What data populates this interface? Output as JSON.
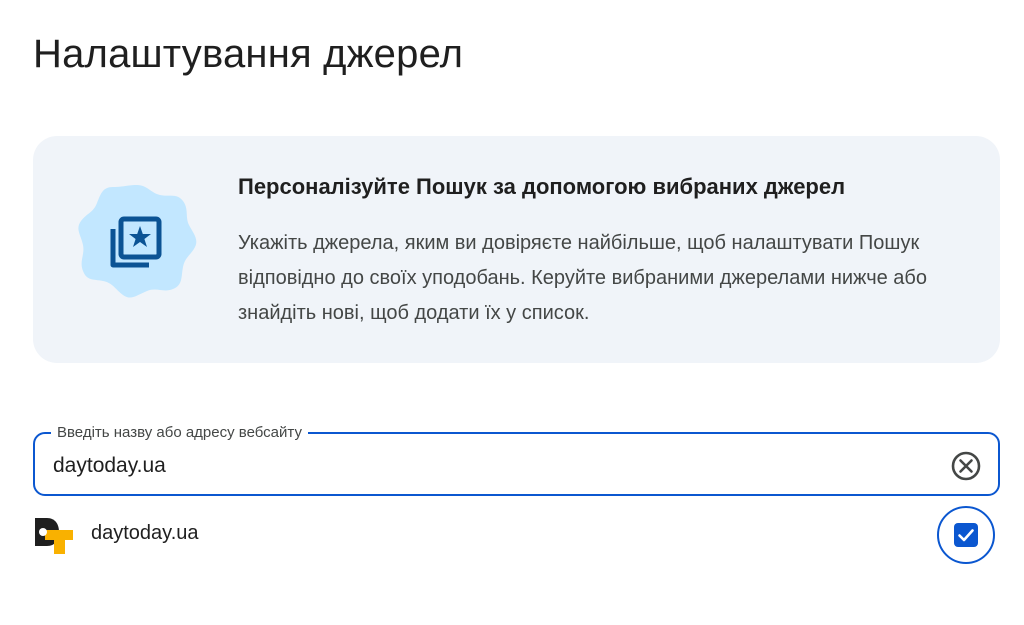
{
  "page": {
    "title": "Налаштування джерел"
  },
  "info_card": {
    "icon": "starred-photo-library-icon",
    "heading": "Персоналізуйте Пошук за допомогою вибраних джерел",
    "body": "Укажіть джерела, яким ви довіряєте найбільше, щоб налаштувати Пошук відповідно до своїх уподобань. Керуйте вибраними джерелами нижче або знайдіть нові, щоб додати їх у список."
  },
  "search": {
    "label": "Введіть назву або адресу вебсайту",
    "value": "daytoday.ua",
    "clear_icon": "clear-circle-icon"
  },
  "results": [
    {
      "name": "daytoday.ua",
      "logo": "daytoday-logo-icon",
      "checked": true
    }
  ],
  "colors": {
    "accent": "#0b57d0",
    "card_background": "#f0f4f9",
    "illustration_bg": "#c2e7ff",
    "illustration_fg": "#0b5394",
    "logo_black": "#1f1f1f",
    "logo_yellow": "#f9b100"
  }
}
